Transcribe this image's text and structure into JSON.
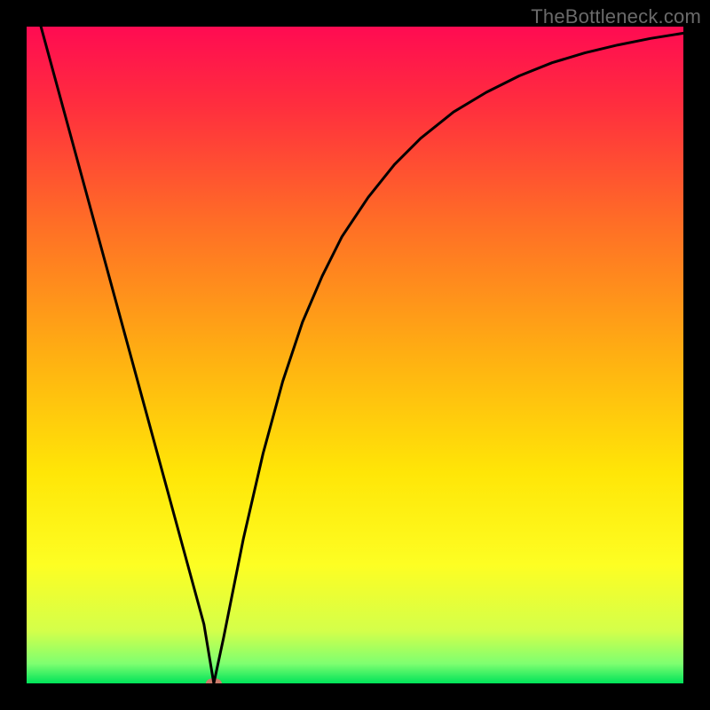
{
  "watermark": "TheBottleneck.com",
  "chart_data": {
    "type": "line",
    "title": "",
    "xlabel": "",
    "ylabel": "",
    "xlim": [
      0,
      100
    ],
    "ylim": [
      0,
      100
    ],
    "background_gradient": {
      "stops": [
        {
          "pos": 0.0,
          "color": "#ff0b52"
        },
        {
          "pos": 0.12,
          "color": "#ff2e3e"
        },
        {
          "pos": 0.3,
          "color": "#ff6e26"
        },
        {
          "pos": 0.5,
          "color": "#ffaf12"
        },
        {
          "pos": 0.68,
          "color": "#ffe607"
        },
        {
          "pos": 0.82,
          "color": "#fdfe23"
        },
        {
          "pos": 0.92,
          "color": "#d4ff4a"
        },
        {
          "pos": 0.97,
          "color": "#7eff70"
        },
        {
          "pos": 1.0,
          "color": "#00e35a"
        }
      ]
    },
    "series": [
      {
        "name": "bottleneck-curve",
        "x": [
          0,
          3,
          6,
          9,
          12,
          15,
          18,
          21,
          24,
          27,
          28.5,
          30,
          33,
          36,
          39,
          42,
          45,
          48,
          52,
          56,
          60,
          65,
          70,
          75,
          80,
          85,
          90,
          95,
          100
        ],
        "values": [
          108,
          97,
          86,
          75,
          64,
          53,
          42,
          31,
          20,
          9,
          0,
          7,
          22,
          35,
          46,
          55,
          62,
          68,
          74,
          79,
          83,
          87,
          90,
          92.5,
          94.5,
          96,
          97.2,
          98.2,
          99
        ]
      }
    ],
    "marker": {
      "x": 28.5,
      "y": 0,
      "color": "#cb7a6a",
      "rx": 9,
      "ry": 6
    }
  }
}
